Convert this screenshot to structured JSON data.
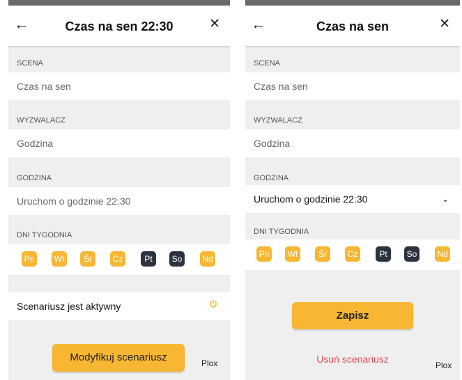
{
  "accent_color": "#f7b733",
  "inactive_day_color": "#2c3340",
  "delete_color": "#e04b5a",
  "left_screen": {
    "title": "Czas na sen 22:30",
    "scene_label": "SCENA",
    "scene_value": "Czas na sen",
    "trigger_label": "WYZWALACZ",
    "trigger_value": "Godzina",
    "time_label": "GODZINA",
    "time_value": "Uruchom o godzinie 22:30",
    "days_label": "DNI TYGODNIA",
    "days": [
      {
        "label": "Pn",
        "active": true
      },
      {
        "label": "Wt",
        "active": true
      },
      {
        "label": "Śr",
        "active": true
      },
      {
        "label": "Cz",
        "active": true
      },
      {
        "label": "Pt",
        "active": false
      },
      {
        "label": "So",
        "active": false
      },
      {
        "label": "Nd",
        "active": true
      }
    ],
    "active_label": "Scenariusz jest aktywny",
    "modify_button": "Modyfikuj scenariusz",
    "brand": "Plox"
  },
  "right_screen": {
    "title": "Czas na sen",
    "scene_label": "SCENA",
    "scene_value": "Czas na sen",
    "trigger_label": "WYZWALACZ",
    "trigger_value": "Godzina",
    "time_label": "GODZINA",
    "time_value": "Uruchom o godzinie 22:30",
    "days_label": "DNI TYGODNIA",
    "days": [
      {
        "label": "Pn",
        "active": true
      },
      {
        "label": "Wt",
        "active": true
      },
      {
        "label": "Śr",
        "active": true
      },
      {
        "label": "Cz",
        "active": true
      },
      {
        "label": "Pt",
        "active": false
      },
      {
        "label": "So",
        "active": false
      },
      {
        "label": "Nd",
        "active": true
      }
    ],
    "save_button": "Zapisz",
    "delete_link": "Usuń scenariusz",
    "brand": "Plox"
  }
}
